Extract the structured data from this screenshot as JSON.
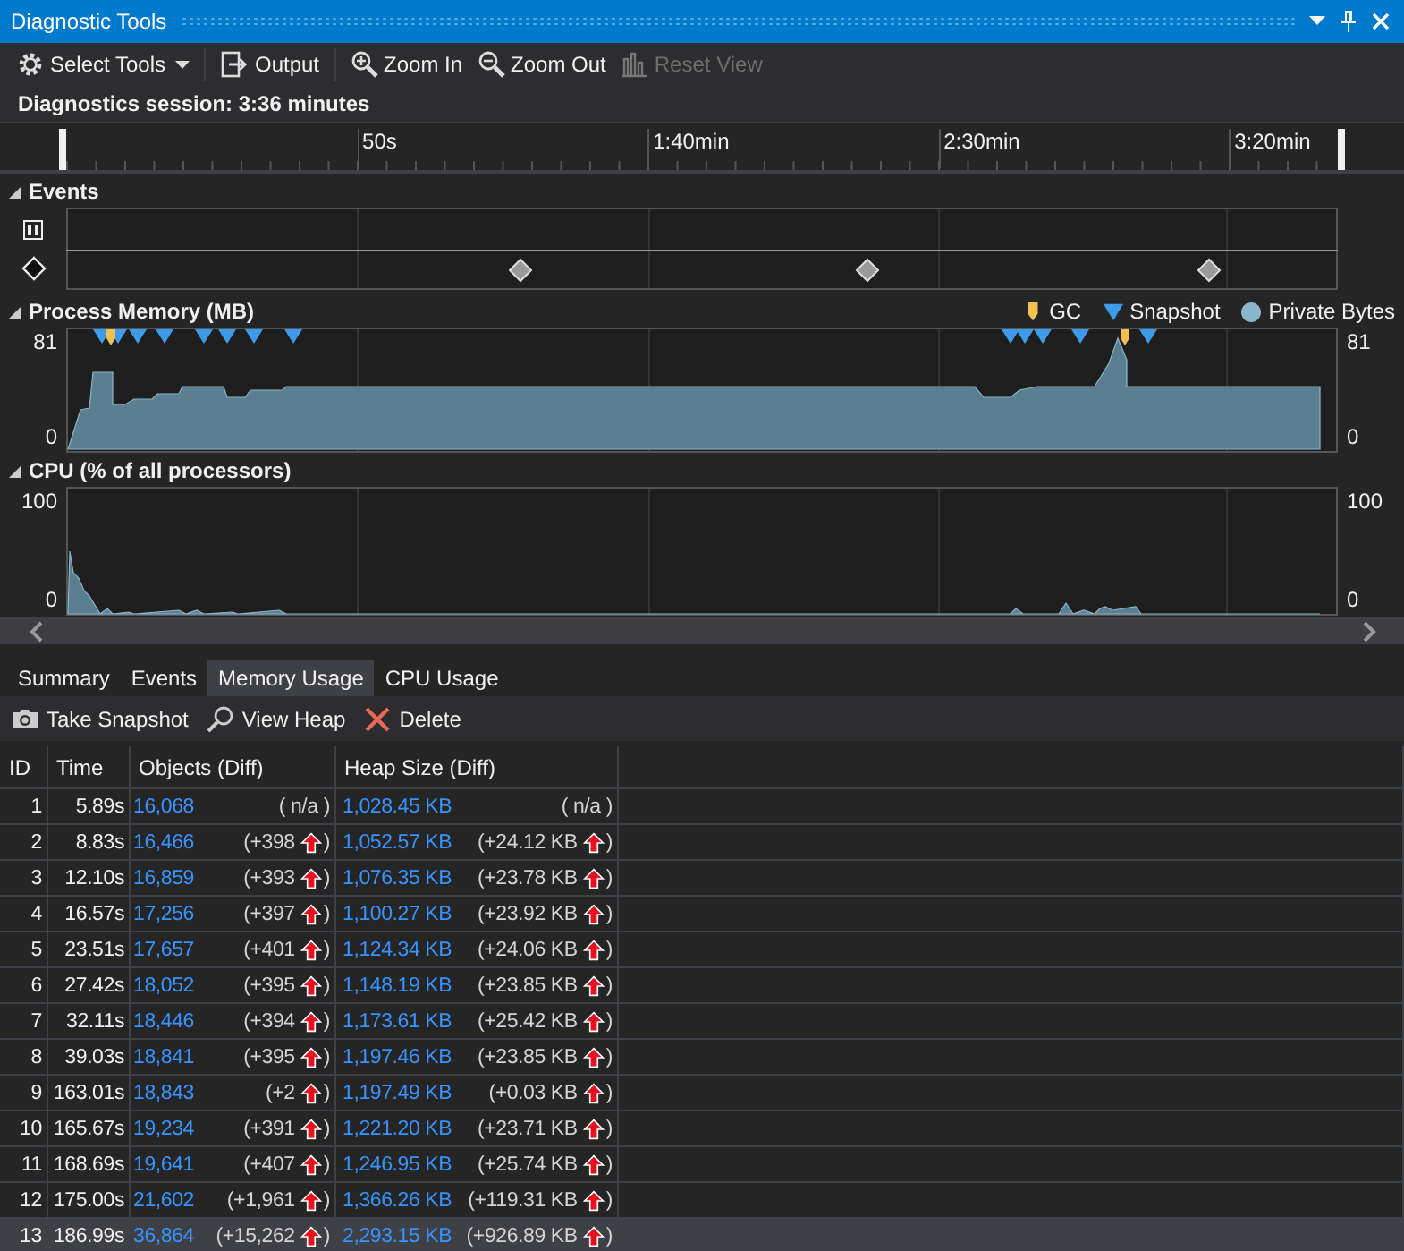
{
  "window": {
    "title": "Diagnostic Tools"
  },
  "toolbar": [
    {
      "kind": "select-tools",
      "label": "Select Tools",
      "disabled": false
    },
    {
      "kind": "output",
      "label": "Output",
      "disabled": false
    },
    {
      "kind": "zoom-in",
      "label": "Zoom In",
      "disabled": false
    },
    {
      "kind": "zoom-out",
      "label": "Zoom Out",
      "disabled": false
    },
    {
      "kind": "reset-view",
      "label": "Reset View",
      "disabled": true
    }
  ],
  "session": "Diagnostics session: 3:36 minutes",
  "timeline": {
    "labels": [
      "50s",
      "1:40min",
      "2:30min",
      "3:20min"
    ]
  },
  "events": {
    "title": "Events"
  },
  "memory": {
    "title": "Process Memory (MB)",
    "left_max": "81",
    "left_min": "0",
    "right_max": "81",
    "right_min": "0",
    "legend": [
      {
        "kind": "gc",
        "label": "GC"
      },
      {
        "kind": "snapshot",
        "label": "Snapshot"
      },
      {
        "kind": "private-bytes",
        "label": "Private Bytes"
      }
    ]
  },
  "cpu": {
    "title": "CPU (% of all processors)",
    "left_max": "100",
    "left_min": "0",
    "right_max": "100",
    "right_min": "0"
  },
  "tabs": [
    {
      "label": "Summary",
      "selected": false
    },
    {
      "label": "Events",
      "selected": false
    },
    {
      "label": "Memory Usage",
      "selected": true
    },
    {
      "label": "CPU Usage",
      "selected": false
    }
  ],
  "actions": [
    {
      "kind": "snapshot",
      "label": "Take Snapshot"
    },
    {
      "kind": "heap",
      "label": "View Heap"
    },
    {
      "kind": "delete",
      "label": "Delete"
    }
  ],
  "table": {
    "columns": [
      "ID",
      "Time",
      "Objects (Diff)",
      "Heap Size (Diff)"
    ],
    "rows": [
      {
        "id": "1",
        "time": "5.89s",
        "objects": "16,068",
        "objects_diff": "( n/a )",
        "objects_up": false,
        "heap": "1,028.45 KB",
        "heap_diff": "( n/a )",
        "heap_up": false,
        "selected": false
      },
      {
        "id": "2",
        "time": "8.83s",
        "objects": "16,466",
        "objects_diff": "(+398",
        "objects_up": true,
        "objects_end": ")",
        "heap": "1,052.57 KB",
        "heap_diff": "(+24.12 KB",
        "heap_up": true,
        "heap_end": ")",
        "selected": false
      },
      {
        "id": "3",
        "time": "12.10s",
        "objects": "16,859",
        "objects_diff": "(+393",
        "objects_up": true,
        "objects_end": ")",
        "heap": "1,076.35 KB",
        "heap_diff": "(+23.78 KB",
        "heap_up": true,
        "heap_end": ")",
        "selected": false
      },
      {
        "id": "4",
        "time": "16.57s",
        "objects": "17,256",
        "objects_diff": "(+397",
        "objects_up": true,
        "objects_end": ")",
        "heap": "1,100.27 KB",
        "heap_diff": "(+23.92 KB",
        "heap_up": true,
        "heap_end": ")",
        "selected": false
      },
      {
        "id": "5",
        "time": "23.51s",
        "objects": "17,657",
        "objects_diff": "(+401",
        "objects_up": true,
        "objects_end": ")",
        "heap": "1,124.34 KB",
        "heap_diff": "(+24.06 KB",
        "heap_up": true,
        "heap_end": ")",
        "selected": false
      },
      {
        "id": "6",
        "time": "27.42s",
        "objects": "18,052",
        "objects_diff": "(+395",
        "objects_up": true,
        "objects_end": ")",
        "heap": "1,148.19 KB",
        "heap_diff": "(+23.85 KB",
        "heap_up": true,
        "heap_end": ")",
        "selected": false
      },
      {
        "id": "7",
        "time": "32.11s",
        "objects": "18,446",
        "objects_diff": "(+394",
        "objects_up": true,
        "objects_end": ")",
        "heap": "1,173.61 KB",
        "heap_diff": "(+25.42 KB",
        "heap_up": true,
        "heap_end": ")",
        "selected": false
      },
      {
        "id": "8",
        "time": "39.03s",
        "objects": "18,841",
        "objects_diff": "(+395",
        "objects_up": true,
        "objects_end": ")",
        "heap": "1,197.46 KB",
        "heap_diff": "(+23.85 KB",
        "heap_up": true,
        "heap_end": ")",
        "selected": false
      },
      {
        "id": "9",
        "time": "163.01s",
        "objects": "18,843",
        "objects_diff": "(+2",
        "objects_up": true,
        "objects_end": ")",
        "heap": "1,197.49 KB",
        "heap_diff": "(+0.03 KB",
        "heap_up": true,
        "heap_end": ")",
        "selected": false
      },
      {
        "id": "10",
        "time": "165.67s",
        "objects": "19,234",
        "objects_diff": "(+391",
        "objects_up": true,
        "objects_end": ")",
        "heap": "1,221.20 KB",
        "heap_diff": "(+23.71 KB",
        "heap_up": true,
        "heap_end": ")",
        "selected": false
      },
      {
        "id": "11",
        "time": "168.69s",
        "objects": "19,641",
        "objects_diff": "(+407",
        "objects_up": true,
        "objects_end": ")",
        "heap": "1,246.95 KB",
        "heap_diff": "(+25.74 KB",
        "heap_up": true,
        "heap_end": ")",
        "selected": false
      },
      {
        "id": "12",
        "time": "175.00s",
        "objects": "21,602",
        "objects_diff": "(+1,961",
        "objects_up": true,
        "objects_end": ")",
        "heap": "1,366.26 KB",
        "heap_diff": "(+119.31 KB",
        "heap_up": true,
        "heap_end": ")",
        "selected": false
      },
      {
        "id": "13",
        "time": "186.99s",
        "objects": "36,864",
        "objects_diff": "(+15,262",
        "objects_up": true,
        "objects_end": ")",
        "heap": "2,293.15 KB",
        "heap_diff": "(+926.89 KB",
        "heap_up": true,
        "heap_end": ")",
        "selected": true
      }
    ]
  }
}
